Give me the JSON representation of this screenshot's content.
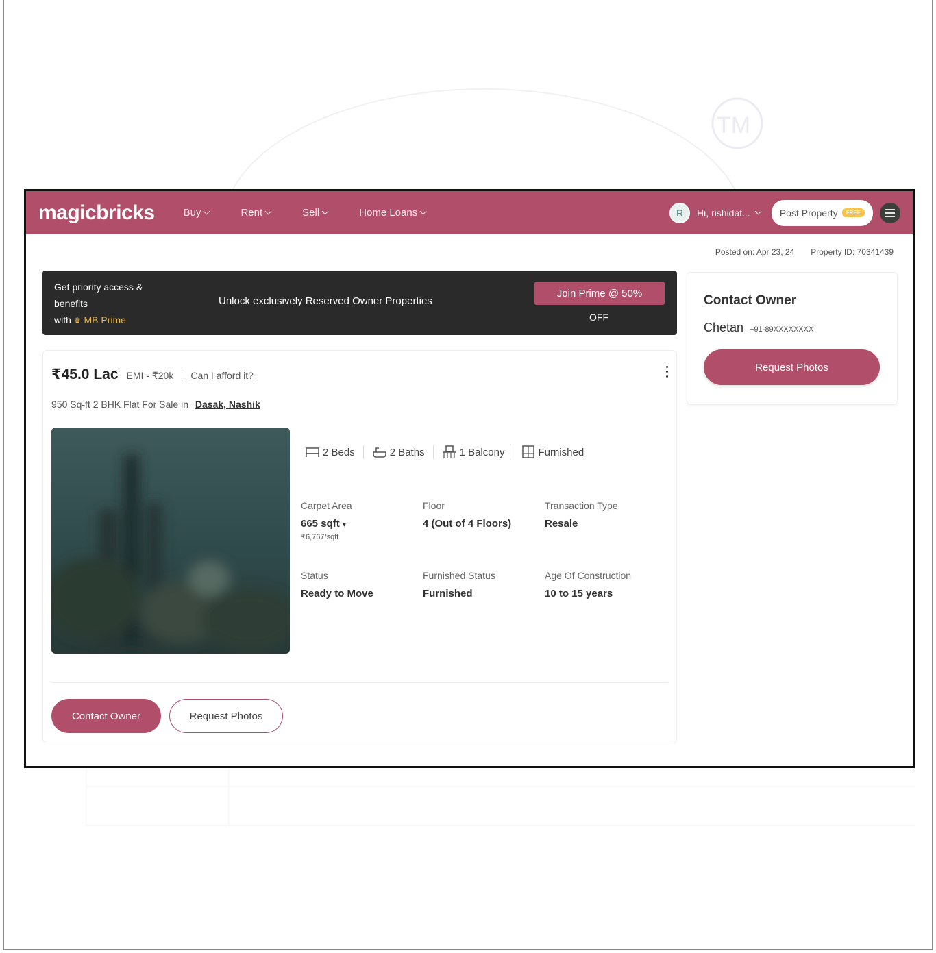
{
  "header": {
    "logo": "magicbricks",
    "nav": [
      {
        "label": "Buy"
      },
      {
        "label": "Rent"
      },
      {
        "label": "Sell"
      },
      {
        "label": "Home Loans"
      }
    ],
    "avatar_initial": "R",
    "user_label": "Hi, rishidat...",
    "post_property_label": "Post Property",
    "post_property_badge": "FREE"
  },
  "meta": {
    "posted_on": "Posted on: Apr 23, 24",
    "property_id": "Property ID: 70341439"
  },
  "prime_banner": {
    "line1": "Get priority access &",
    "line2": "benefits",
    "line3_prefix": "with",
    "line3_brand": "MB Prime",
    "center_text": "Unlock exclusively Reserved Owner Properties",
    "button_label": "Join Prime @ 50%",
    "button_sub": "OFF"
  },
  "contact_card": {
    "title": "Contact Owner",
    "name": "Chetan",
    "phone": "+91-89XXXXXXXX",
    "button_label": "Request Photos"
  },
  "listing": {
    "price": "₹45.0 Lac",
    "emi_label": "EMI - ₹20k",
    "afford_label": "Can I afford it?",
    "subtitle": "950 Sq-ft 2 BHK Flat For Sale in",
    "location": "Dasak, Nashik",
    "amenities": {
      "beds": "2 Beds",
      "baths": "2 Baths",
      "balcony": "1 Balcony",
      "furnished": "Furnished"
    },
    "specs": {
      "carpet_label": "Carpet Area",
      "carpet_value": "665 sqft",
      "carpet_rate": "₹6,767/sqft",
      "floor_label": "Floor",
      "floor_value": "4 (Out of 4 Floors)",
      "transaction_label": "Transaction Type",
      "transaction_value": "Resale",
      "status_label": "Status",
      "status_value": "Ready to Move",
      "furnished_label": "Furnished Status",
      "furnished_value": "Furnished",
      "age_label": "Age Of Construction",
      "age_value": "10 to 15 years"
    },
    "contact_button": "Contact Owner",
    "request_button": "Request Photos"
  },
  "colors": {
    "brand": "#b14e69",
    "banner_bg": "#2a2a2a",
    "gold": "#e7b34a"
  }
}
